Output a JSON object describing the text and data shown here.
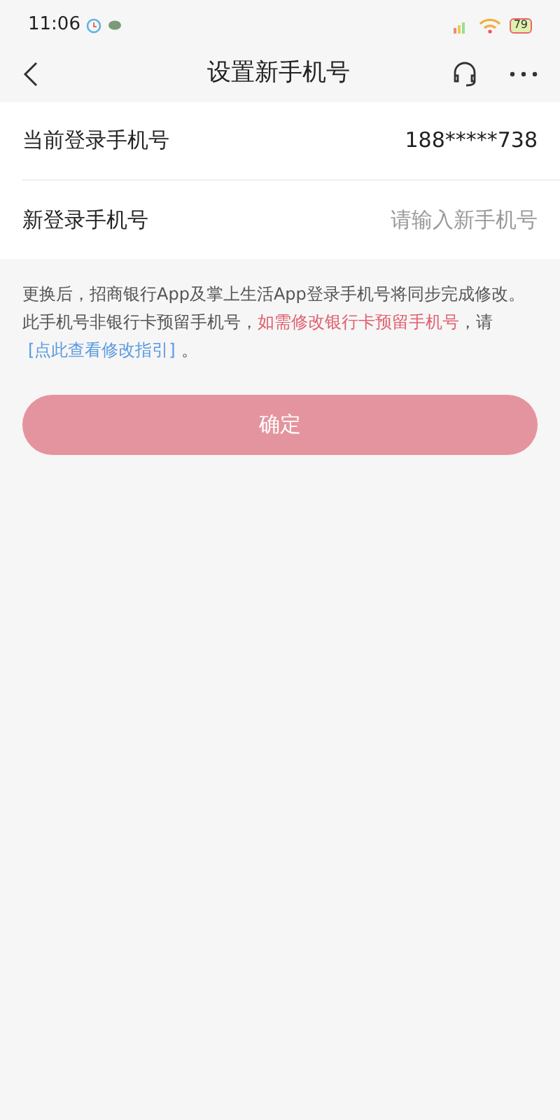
{
  "status_bar": {
    "time": "11:06",
    "battery": "79"
  },
  "header": {
    "title": "设置新手机号"
  },
  "form": [
    {
      "label": "当前登录手机号",
      "value": "188*****738"
    },
    {
      "label": "新登录手机号",
      "placeholder": "请输入新手机号"
    }
  ],
  "notice": {
    "line1": "更换后，招商银行App及掌上生活App登录手机号将同步完成修改。",
    "line2_prefix": "此手机号非银行卡预留手机号，",
    "line2_highlight": "如需修改银行卡预留手机号",
    "line2_middle": "，请",
    "link": "[点此查看修改指引]",
    "line2_suffix": "。"
  },
  "confirm_button": {
    "label": "确定",
    "disabled": true
  }
}
